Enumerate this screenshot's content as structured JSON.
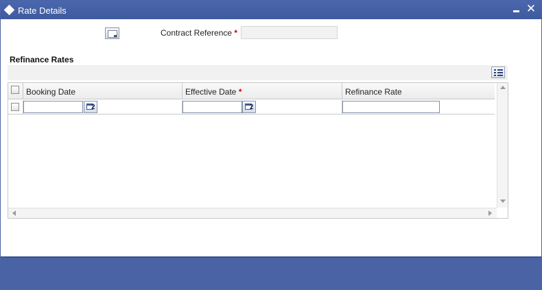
{
  "window": {
    "title": "Rate Details",
    "minimize_icon": "minimize-icon",
    "close_icon": "close-icon",
    "close_glyph": "✕"
  },
  "header": {
    "contract_reference_label": "Contract Reference",
    "required_mark": "*",
    "contract_reference_value": ""
  },
  "section": {
    "title": "Refinance Rates",
    "list_view_icon": "list-view-icon"
  },
  "grid": {
    "columns": [
      {
        "label": "Booking Date",
        "required": false
      },
      {
        "label": "Effective Date",
        "required": true
      },
      {
        "label": "Refinance Rate",
        "required": false
      }
    ],
    "rows": [
      {
        "booking_date": "",
        "effective_date": "",
        "refinance_rate": "",
        "selected": false
      }
    ],
    "calendar_glyph": "2"
  },
  "colors": {
    "titlebar": "#4b67ad",
    "footer": "#4a63a4",
    "required": "#d00000"
  }
}
